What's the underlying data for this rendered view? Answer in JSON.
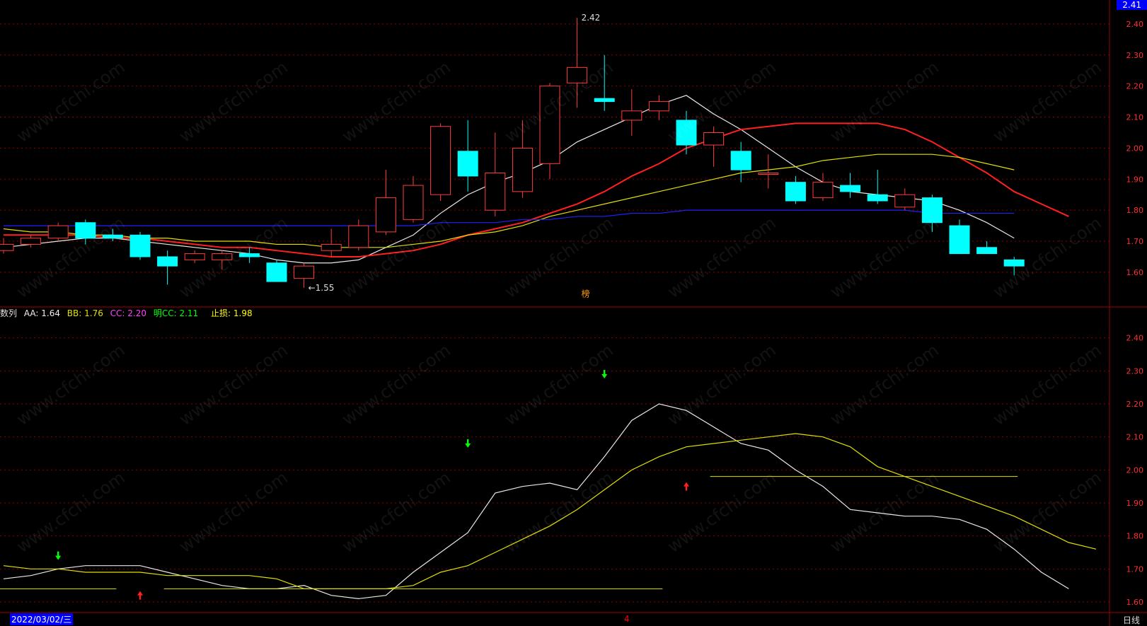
{
  "colors": {
    "up": "#ff3b3b",
    "down": "#00ffff",
    "grid": "#8b0000",
    "ma5": "#e8e8e8",
    "ma10": "#ff2020",
    "ma20": "#e0e000",
    "ma60": "#2020ff"
  },
  "chart_data": [
    {
      "type": "candlestick",
      "ylim": [
        1.52,
        2.45
      ],
      "yticks": [
        1.6,
        1.7,
        1.8,
        1.9,
        2.0,
        2.1,
        2.2,
        2.3,
        2.4
      ],
      "candles": [
        [
          1.67,
          1.69,
          1.66,
          1.71
        ],
        [
          1.69,
          1.71,
          1.68,
          1.72
        ],
        [
          1.71,
          1.75,
          1.7,
          1.76
        ],
        [
          1.76,
          1.71,
          1.69,
          1.77
        ],
        [
          1.72,
          1.71,
          1.7,
          1.74
        ],
        [
          1.72,
          1.65,
          1.64,
          1.73
        ],
        [
          1.65,
          1.62,
          1.56,
          1.67
        ],
        [
          1.64,
          1.66,
          1.63,
          1.67
        ],
        [
          1.64,
          1.66,
          1.61,
          1.67
        ],
        [
          1.66,
          1.65,
          1.63,
          1.68
        ],
        [
          1.63,
          1.57,
          1.57,
          1.64
        ],
        [
          1.58,
          1.62,
          1.55,
          1.63
        ],
        [
          1.67,
          1.69,
          1.65,
          1.74
        ],
        [
          1.68,
          1.75,
          1.67,
          1.77
        ],
        [
          1.73,
          1.84,
          1.72,
          1.93
        ],
        [
          1.77,
          1.88,
          1.76,
          1.91
        ],
        [
          1.85,
          2.07,
          1.83,
          2.08
        ],
        [
          1.99,
          1.91,
          1.86,
          2.09
        ],
        [
          1.8,
          1.92,
          1.78,
          2.05
        ],
        [
          1.86,
          2.0,
          1.84,
          2.09
        ],
        [
          1.95,
          2.2,
          1.9,
          2.21
        ],
        [
          2.21,
          2.26,
          2.13,
          2.42
        ],
        [
          2.16,
          2.15,
          2.12,
          2.3
        ],
        [
          2.09,
          2.12,
          2.04,
          2.19
        ],
        [
          2.12,
          2.15,
          2.09,
          2.17
        ],
        [
          2.09,
          2.01,
          1.98,
          2.12
        ],
        [
          2.01,
          2.05,
          1.94,
          2.07
        ],
        [
          1.99,
          1.93,
          1.89,
          2.02
        ],
        [
          1.92,
          1.92,
          1.87,
          1.98
        ],
        [
          1.89,
          1.83,
          1.82,
          1.91
        ],
        [
          1.84,
          1.89,
          1.83,
          1.92
        ],
        [
          1.88,
          1.86,
          1.84,
          1.92
        ],
        [
          1.85,
          1.83,
          1.82,
          1.93
        ],
        [
          1.81,
          1.85,
          1.8,
          1.87
        ],
        [
          1.84,
          1.76,
          1.73,
          1.85
        ],
        [
          1.75,
          1.66,
          1.66,
          1.77
        ],
        [
          1.68,
          1.66,
          1.66,
          1.7
        ],
        [
          1.64,
          1.62,
          1.59,
          1.65
        ]
      ],
      "series": [
        {
          "color_key": "ma5",
          "values": [
            1.68,
            1.69,
            1.7,
            1.71,
            1.71,
            1.7,
            1.69,
            1.68,
            1.67,
            1.66,
            1.64,
            1.63,
            1.63,
            1.64,
            1.68,
            1.72,
            1.79,
            1.85,
            1.89,
            1.92,
            1.96,
            2.02,
            2.06,
            2.1,
            2.14,
            2.17,
            2.11,
            2.06,
            2.0,
            1.94,
            1.89,
            1.86,
            1.85,
            1.84,
            1.83,
            1.8,
            1.76,
            1.71
          ]
        },
        {
          "color_key": "ma10",
          "values": [
            1.72,
            1.72,
            1.72,
            1.72,
            1.71,
            1.71,
            1.7,
            1.69,
            1.68,
            1.68,
            1.67,
            1.66,
            1.65,
            1.65,
            1.66,
            1.67,
            1.69,
            1.72,
            1.74,
            1.76,
            1.79,
            1.82,
            1.86,
            1.91,
            1.95,
            2.0,
            2.03,
            2.06,
            2.07,
            2.08,
            2.08,
            2.08,
            2.08,
            2.06,
            2.02,
            1.97,
            1.92,
            1.86,
            1.82,
            1.78
          ]
        },
        {
          "color_key": "ma20",
          "values": [
            1.74,
            1.73,
            1.73,
            1.72,
            1.72,
            1.71,
            1.71,
            1.7,
            1.7,
            1.7,
            1.69,
            1.69,
            1.68,
            1.68,
            1.68,
            1.69,
            1.7,
            1.72,
            1.73,
            1.75,
            1.78,
            1.8,
            1.82,
            1.84,
            1.86,
            1.88,
            1.9,
            1.92,
            1.93,
            1.94,
            1.96,
            1.97,
            1.98,
            1.98,
            1.98,
            1.97,
            1.95,
            1.93
          ]
        },
        {
          "color_key": "ma60",
          "values": [
            1.75,
            1.75,
            1.75,
            1.75,
            1.75,
            1.75,
            1.75,
            1.75,
            1.75,
            1.75,
            1.75,
            1.75,
            1.75,
            1.75,
            1.75,
            1.75,
            1.76,
            1.76,
            1.76,
            1.77,
            1.77,
            1.78,
            1.78,
            1.79,
            1.79,
            1.8,
            1.8,
            1.8,
            1.8,
            1.8,
            1.8,
            1.8,
            1.8,
            1.8,
            1.79,
            1.79,
            1.79,
            1.79
          ]
        }
      ],
      "annotations": [
        {
          "label": "2.42",
          "index": 21,
          "value": 2.42
        },
        {
          "label": "←1.55",
          "index": 11,
          "value": 1.55
        },
        {
          "label": "榜",
          "index": 21,
          "value": 1.53
        }
      ]
    },
    {
      "type": "line",
      "ylim": [
        1.57,
        2.47
      ],
      "yticks": [
        1.6,
        1.7,
        1.8,
        1.9,
        2.0,
        2.1,
        2.2,
        2.3,
        2.4
      ],
      "series": [
        {
          "color_key": "ma5",
          "values": [
            1.67,
            1.68,
            1.7,
            1.71,
            1.71,
            1.71,
            1.69,
            1.67,
            1.65,
            1.64,
            1.64,
            1.65,
            1.62,
            1.61,
            1.62,
            1.69,
            1.75,
            1.81,
            1.93,
            1.95,
            1.96,
            1.94,
            2.04,
            2.15,
            2.2,
            2.18,
            2.13,
            2.08,
            2.06,
            2.0,
            1.95,
            1.88,
            1.87,
            1.86,
            1.86,
            1.85,
            1.82,
            1.76,
            1.69,
            1.64
          ]
        },
        {
          "color_key": "ma20",
          "values": [
            1.71,
            1.7,
            1.7,
            1.69,
            1.69,
            1.69,
            1.68,
            1.68,
            1.68,
            1.68,
            1.67,
            1.64,
            1.64,
            1.64,
            1.64,
            1.65,
            1.69,
            1.71,
            1.75,
            1.79,
            1.83,
            1.88,
            1.94,
            2.0,
            2.04,
            2.07,
            2.08,
            2.09,
            2.1,
            2.11,
            2.1,
            2.07,
            2.01,
            1.98,
            1.95,
            1.92,
            1.89,
            1.86,
            1.82,
            1.78,
            1.76
          ]
        }
      ],
      "stop_lines": [
        {
          "value": 1.64,
          "from": 0,
          "to": 4
        },
        {
          "value": 1.64,
          "from": 6,
          "to": 24
        },
        {
          "value": 1.98,
          "from": 26,
          "to": 37
        }
      ],
      "arrows": [
        {
          "dir": "down",
          "index": 2,
          "value": 1.74,
          "color": "#00ff00"
        },
        {
          "dir": "up",
          "index": 5,
          "value": 1.62,
          "color": "#ff2020"
        },
        {
          "dir": "down",
          "index": 17,
          "value": 2.08,
          "color": "#00ff00"
        },
        {
          "dir": "down",
          "index": 22,
          "value": 2.29,
          "color": "#00ff00"
        },
        {
          "dir": "up",
          "index": 25,
          "value": 1.95,
          "color": "#ff2020"
        }
      ]
    }
  ],
  "indicator_header": {
    "name": "数列",
    "aa_label": "AA: 1.64",
    "bb_label": "BB: 1.76",
    "cc_label": "CC: 2.20",
    "mcc_label": "明CC: 2.11",
    "stop_label": "止损: 1.98"
  },
  "top_price": "2.41",
  "date_label": "2022/03/02/三",
  "period_label": "日线",
  "mid_label": "4",
  "watermark": "www.cfchi.com"
}
